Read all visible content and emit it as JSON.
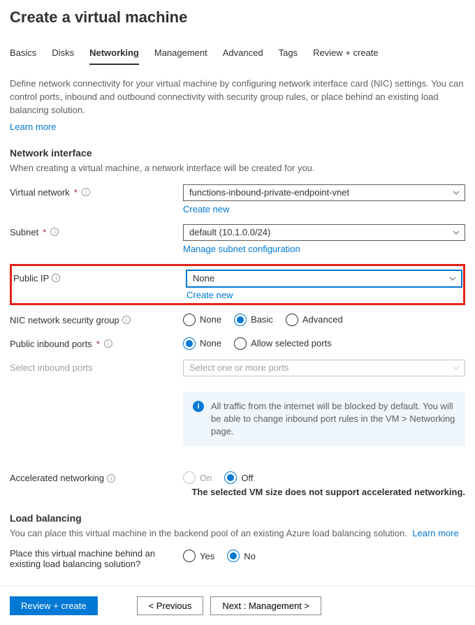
{
  "page_title": "Create a virtual machine",
  "tabs": {
    "basics": "Basics",
    "disks": "Disks",
    "networking": "Networking",
    "management": "Management",
    "advanced": "Advanced",
    "tags": "Tags",
    "review": "Review + create"
  },
  "intro": {
    "text": "Define network connectivity for your virtual machine by configuring network interface card (NIC) settings. You can control ports, inbound and outbound connectivity with security group rules, or place behind an existing load balancing solution.",
    "learn_more": "Learn more"
  },
  "network_interface": {
    "heading": "Network interface",
    "subtext": "When creating a virtual machine, a network interface will be created for you."
  },
  "vnet": {
    "label": "Virtual network",
    "value": "functions-inbound-private-endpoint-vnet",
    "create_new": "Create new"
  },
  "subnet": {
    "label": "Subnet",
    "value": "default (10.1.0.0/24)",
    "manage": "Manage subnet configuration"
  },
  "public_ip": {
    "label": "Public IP",
    "value": "None",
    "create_new": "Create new"
  },
  "nsg": {
    "label": "NIC network security group",
    "options": {
      "none": "None",
      "basic": "Basic",
      "advanced": "Advanced"
    }
  },
  "inbound_ports": {
    "label": "Public inbound ports",
    "options": {
      "none": "None",
      "allow": "Allow selected ports"
    }
  },
  "select_ports": {
    "label": "Select inbound ports",
    "placeholder": "Select one or more ports"
  },
  "infobox": {
    "text": "All traffic from the internet will be blocked by default. You will be able to change inbound port rules in the VM > Networking page."
  },
  "accel": {
    "label": "Accelerated networking",
    "options": {
      "on": "On",
      "off": "Off"
    },
    "note": "The selected VM size does not support accelerated networking."
  },
  "load_balancing": {
    "heading": "Load balancing",
    "subtext": "You can place this virtual machine in the backend pool of an existing Azure load balancing solution.",
    "learn_more": "Learn more",
    "question": "Place this virtual machine behind an existing load balancing solution?",
    "options": {
      "yes": "Yes",
      "no": "No"
    }
  },
  "footer": {
    "review": "Review + create",
    "previous": "< Previous",
    "next": "Next : Management >"
  }
}
